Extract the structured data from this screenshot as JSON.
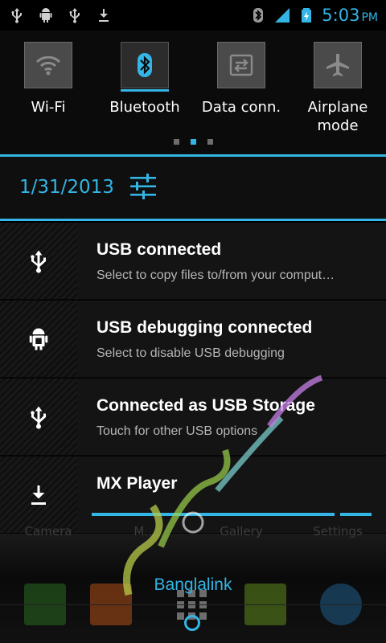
{
  "status_bar": {
    "clock": "5:03",
    "ampm": "PM",
    "left_icons": [
      "usb-icon",
      "android-debug-icon",
      "usb-icon",
      "download-icon"
    ],
    "right_icons": [
      "bluetooth-icon",
      "signal-icon",
      "battery-charging-icon"
    ]
  },
  "quick_settings": {
    "tiles": [
      {
        "label": "Wi-Fi",
        "icon": "wifi-icon",
        "active": false
      },
      {
        "label": "Bluetooth",
        "icon": "bluetooth-icon",
        "active": true
      },
      {
        "label": "Data conn.",
        "icon": "data-connection-icon",
        "active": false
      },
      {
        "label": "Airplane mode",
        "icon": "airplane-icon",
        "active": false
      }
    ],
    "page_count": 3,
    "active_page": 2
  },
  "header": {
    "date": "1/31/2013",
    "settings_icon": "sliders-icon"
  },
  "notifications": [
    {
      "title": "USB connected",
      "text": "Select to copy files to/from your comput…",
      "icon": "usb-icon"
    },
    {
      "title": "USB debugging connected",
      "text": "Select to disable USB debugging",
      "icon": "android-debug-icon"
    },
    {
      "title": "Connected as USB Storage",
      "text": "Touch for other USB options",
      "icon": "usb-icon"
    },
    {
      "title": "MX Player",
      "text": "",
      "icon": "download-icon",
      "progress": 0.87
    }
  ],
  "home": {
    "app_labels": [
      "Camera",
      "M...",
      "Gallery",
      "Settings"
    ],
    "carrier": "Banglalink"
  },
  "colors": {
    "accent": "#33b5e5",
    "background": "#000000",
    "notification_bg": "#141414"
  }
}
